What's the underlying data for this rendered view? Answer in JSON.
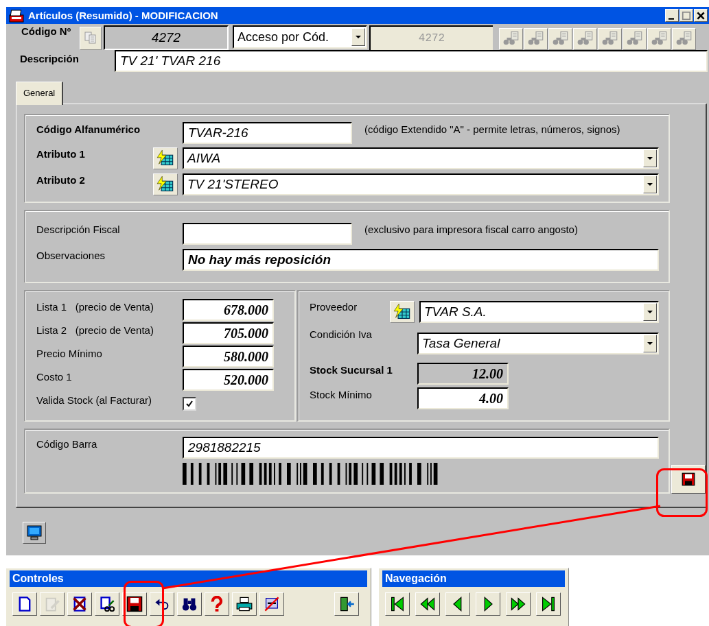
{
  "window": {
    "title": "Artículos (Resumido) - MODIFICACION"
  },
  "header": {
    "code_label": "Código Nº",
    "code_value": "4272",
    "access_mode": "Acceso por Cód.",
    "code_display": "4272",
    "description_label": "Descripción",
    "description_value": "TV 21' TVAR 216"
  },
  "tabs": [
    {
      "label": "General",
      "selected": true
    }
  ],
  "general": {
    "alpha_code": {
      "label": "Código Alfanumérico",
      "value": "TVAR-216",
      "note": "(código Extendido \"A\" - permite letras, números, signos)"
    },
    "attributes": [
      {
        "label": "Atributo 1",
        "value": "AIWA"
      },
      {
        "label": "Atributo 2",
        "value": "TV 21'STEREO"
      }
    ],
    "fiscal": {
      "label": "Descripción Fiscal",
      "note": "(exclusivo para impresora fiscal carro angosto)"
    },
    "observations": {
      "label": "Observaciones",
      "value": "No hay más reposición"
    },
    "prices": [
      {
        "label": "Lista 1   (precio de Venta)",
        "value": "678.000"
      },
      {
        "label": "Lista 2   (precio de Venta)",
        "value": "705.000"
      },
      {
        "label": "Precio Mínimo",
        "value": "580.000"
      },
      {
        "label": "Costo 1",
        "value": "520.000"
      }
    ],
    "validate_stock": {
      "label": "Valida Stock (al Facturar)",
      "checked": true
    },
    "supplier": {
      "label": "Proveedor",
      "value": "TVAR S.A."
    },
    "iva": {
      "label": "Condición Iva",
      "value": "Tasa General"
    },
    "stock_branch": {
      "label": "Stock Sucursal 1",
      "value": "12.00"
    },
    "stock_min": {
      "label": "Stock Mínimo",
      "value": "4.00"
    },
    "barcode": {
      "label": "Código Barra",
      "value": "2981882215"
    }
  },
  "toolbars": [
    {
      "title": "Controles",
      "buttons": [
        {
          "kind": "new",
          "disabled": false
        },
        {
          "kind": "edit",
          "disabled": true
        },
        {
          "kind": "delete",
          "disabled": false
        },
        {
          "kind": "modify",
          "disabled": false
        },
        {
          "kind": "save",
          "disabled": false
        },
        {
          "kind": "undo",
          "disabled": false
        },
        {
          "kind": "search",
          "disabled": false
        },
        {
          "kind": "help",
          "disabled": false
        },
        {
          "kind": "print",
          "disabled": false
        },
        {
          "kind": "unlink",
          "disabled": false
        },
        {
          "kind": "exit",
          "disabled": false
        }
      ]
    },
    {
      "title": "Navegación",
      "buttons": [
        {
          "kind": "first",
          "disabled": false
        },
        {
          "kind": "prev-page",
          "disabled": false
        },
        {
          "kind": "prev",
          "disabled": false
        },
        {
          "kind": "next",
          "disabled": false
        },
        {
          "kind": "next-page",
          "disabled": false
        },
        {
          "kind": "last",
          "disabled": false
        }
      ]
    }
  ]
}
